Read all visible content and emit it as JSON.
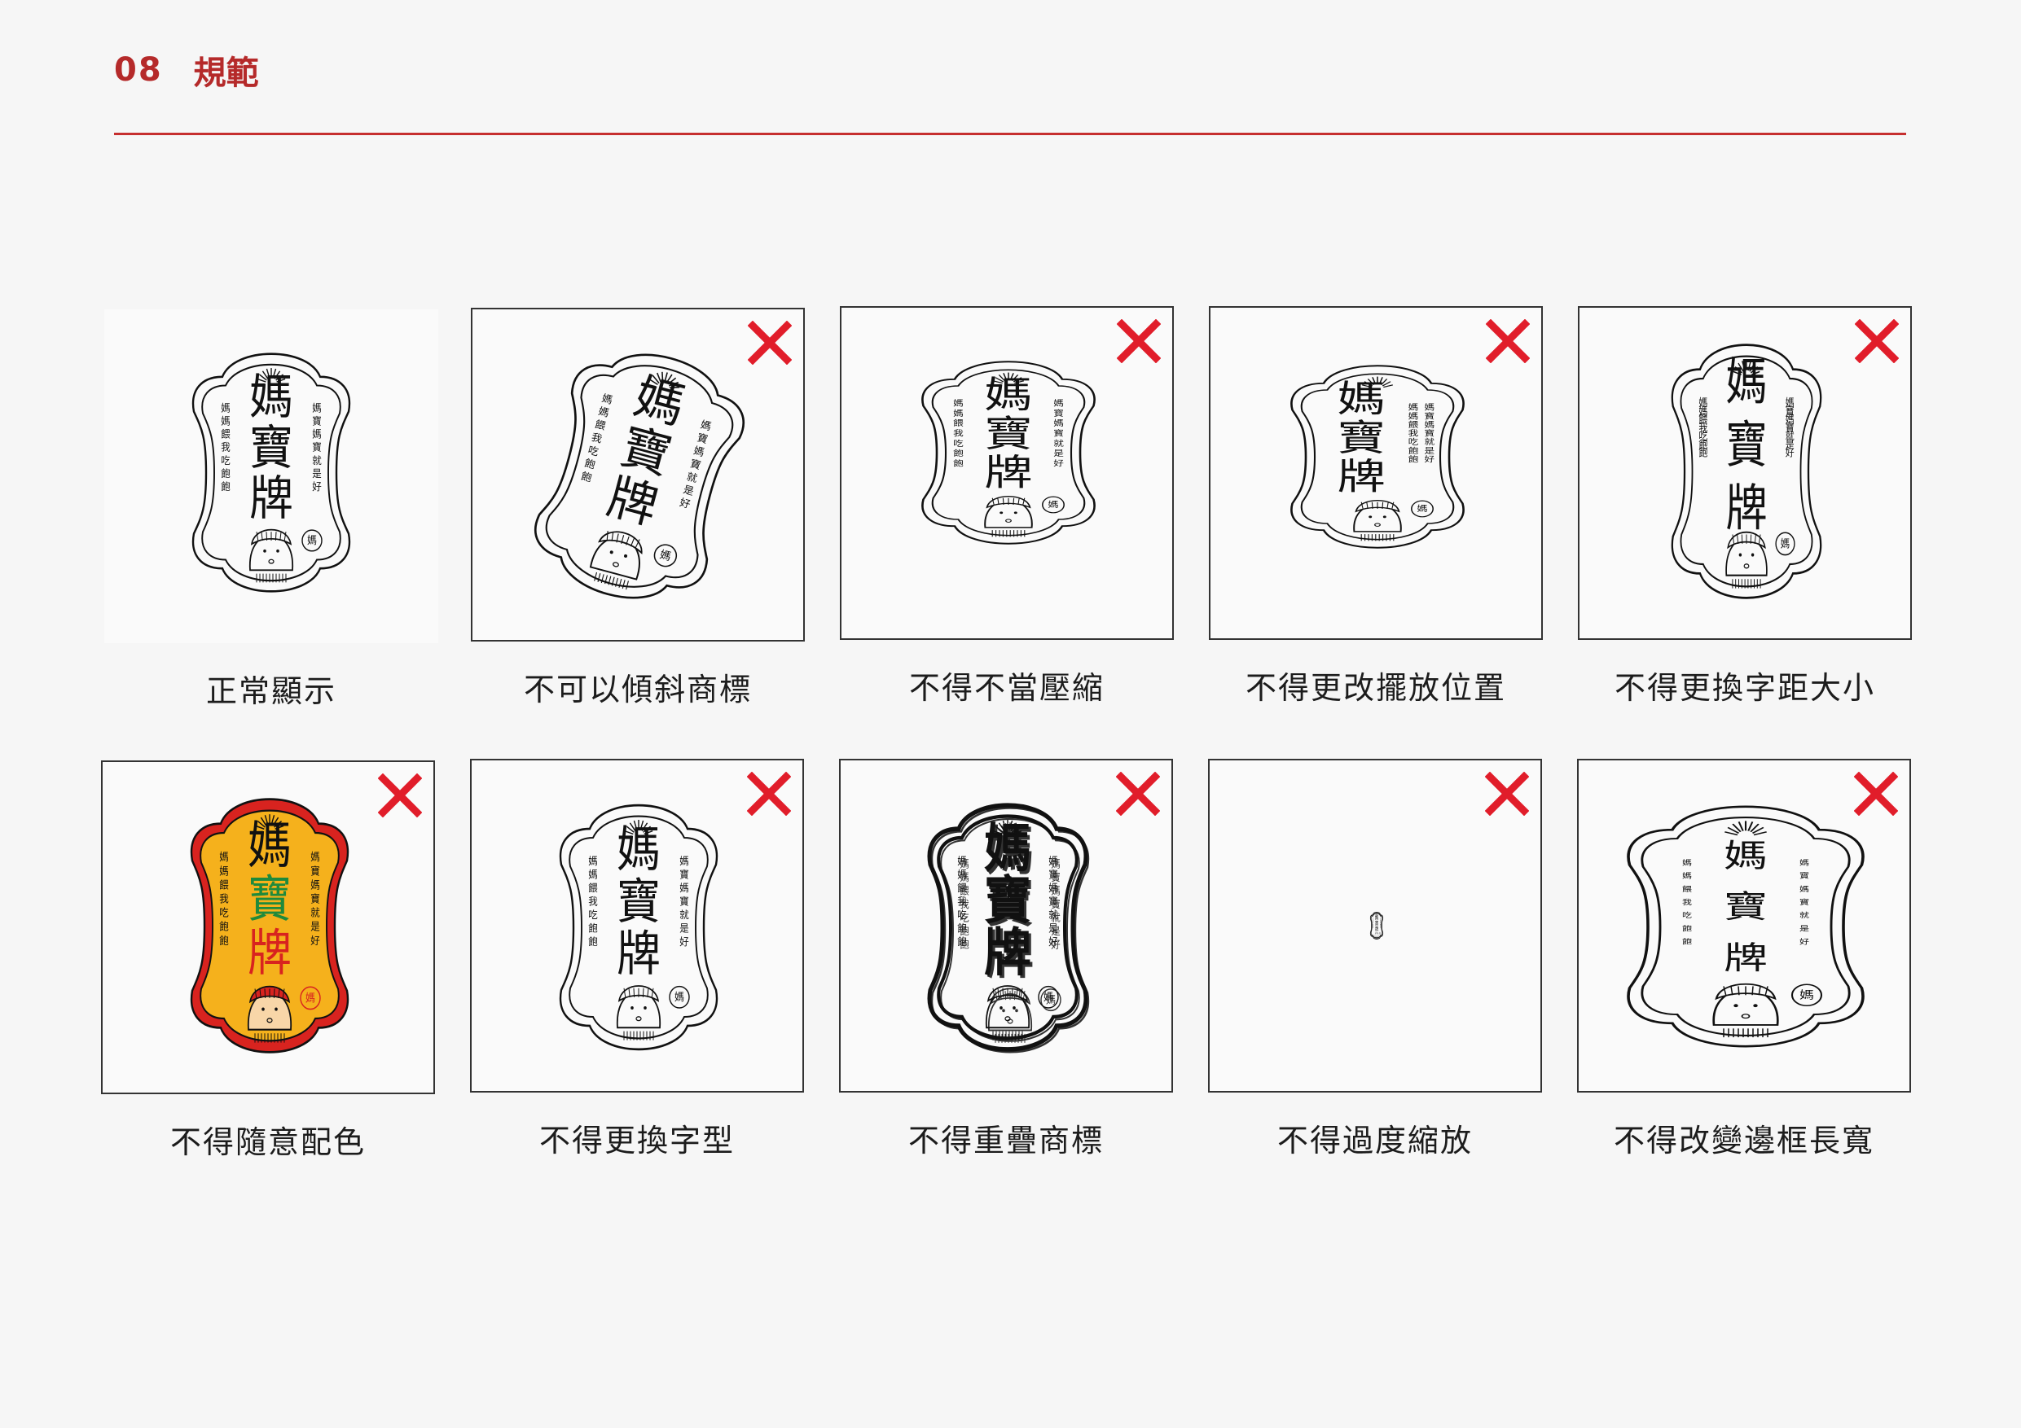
{
  "header": {
    "section_number": "08",
    "section_title": "規範"
  },
  "logo": {
    "name_chars": [
      "媽",
      "寶",
      "牌"
    ],
    "tagline_right": "媽寶媽寶就是好",
    "tagline_left": "媽媽餵我吃飽飽",
    "badge_char": "媽"
  },
  "colors": {
    "accent": "#c62f2f",
    "cross": "#e11d2a",
    "stroke": "#111111",
    "alt_fill": "#f5b11c",
    "alt_border": "#d8231f",
    "alt_green": "#1f8a3c"
  },
  "icons": {
    "cross": "red-x-icon"
  },
  "items": [
    {
      "caption": "正常顯示",
      "correct": true
    },
    {
      "caption": "不可以傾斜商標",
      "correct": false
    },
    {
      "caption": "不得不當壓縮",
      "correct": false
    },
    {
      "caption": "不得更改擺放位置",
      "correct": false
    },
    {
      "caption": "不得更換字距大小",
      "correct": false
    },
    {
      "caption": "不得隨意配色",
      "correct": false
    },
    {
      "caption": "不得更換字型",
      "correct": false
    },
    {
      "caption": "不得重疊商標",
      "correct": false
    },
    {
      "caption": "不得過度縮放",
      "correct": false
    },
    {
      "caption": "不得改變邊框長寬",
      "correct": false
    }
  ]
}
